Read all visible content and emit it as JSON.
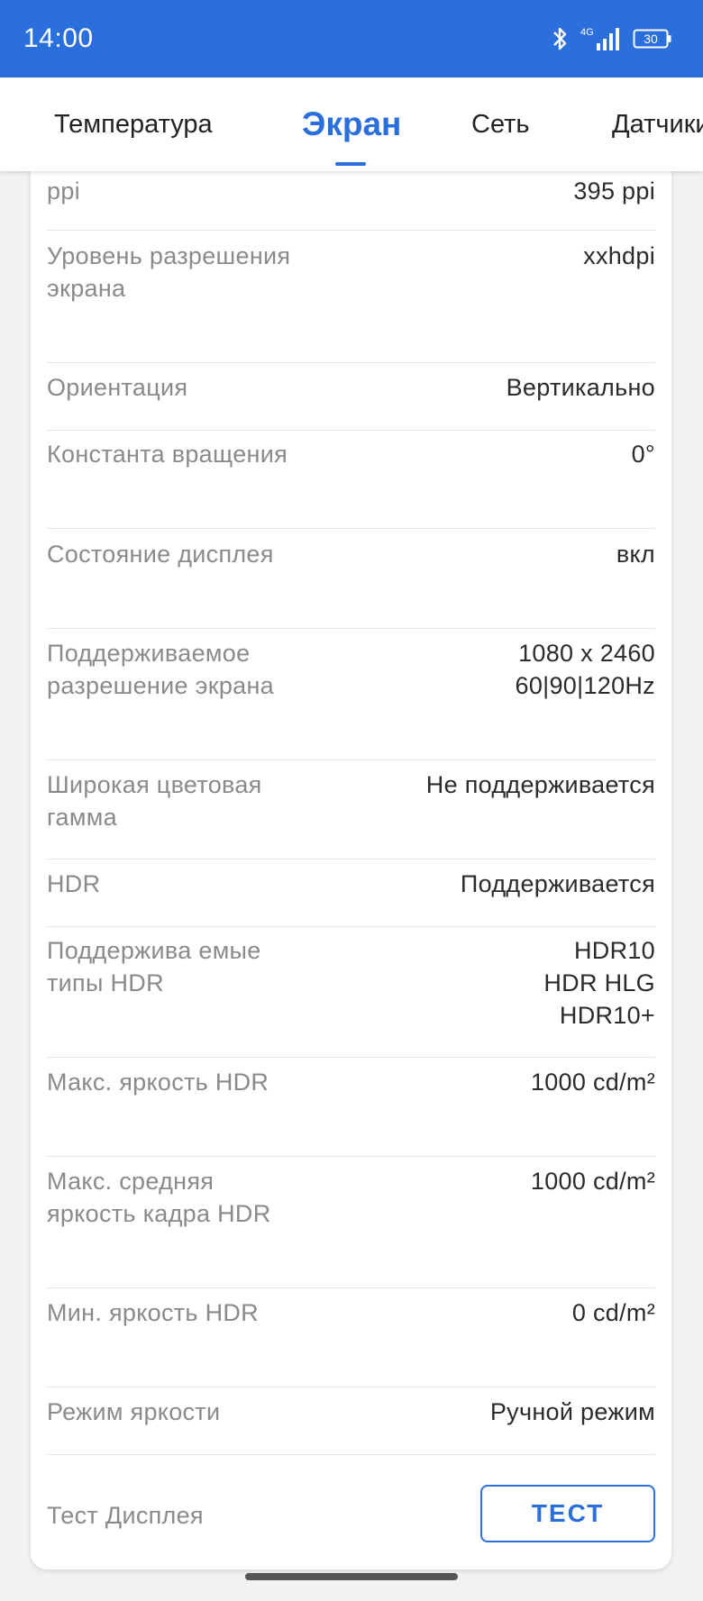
{
  "status_bar": {
    "time": "14:00",
    "network": "4G",
    "battery": "30",
    "icons": [
      "bluetooth-icon",
      "signal-icon",
      "battery-icon"
    ]
  },
  "tabs": [
    {
      "label": "Температура",
      "active": false
    },
    {
      "label": "Экран",
      "active": true
    },
    {
      "label": "Сеть",
      "active": false
    },
    {
      "label": "Датчики",
      "active": false
    }
  ],
  "rows": [
    {
      "label": "ppi",
      "value": [
        "395 ppi"
      ]
    },
    {
      "label": "Уровень разрешения экрана",
      "value": [
        "xxhdpi"
      ]
    },
    {
      "label": "Ориентация",
      "value": [
        "Вертикально"
      ]
    },
    {
      "label": "Константа вращения",
      "value": [
        "0°"
      ]
    },
    {
      "label": "Состояние дисплея",
      "value": [
        "вкл"
      ]
    },
    {
      "label": "Поддерживаемое разрешение экрана",
      "value": [
        "1080 x 2460",
        "60|90|120Hz"
      ]
    },
    {
      "label": "Широкая цветовая гамма",
      "value": [
        "Не поддерживается"
      ]
    },
    {
      "label": "HDR",
      "value": [
        "Поддерживается"
      ]
    },
    {
      "label": "Поддержива емые типы HDR",
      "value": [
        "HDR10",
        "HDR HLG",
        "HDR10+"
      ]
    },
    {
      "label": "Макс. яркость HDR",
      "value": [
        "1000 cd/m²"
      ]
    },
    {
      "label": "Макс. средняя яркость кадра HDR",
      "value": [
        "1000 cd/m²"
      ]
    },
    {
      "label": "Мин. яркость HDR",
      "value": [
        "0 cd/m²"
      ]
    },
    {
      "label": "Режим яркости",
      "value": [
        "Ручной режим"
      ]
    }
  ],
  "display_test": {
    "label": "Тест Дисплея",
    "button_label": "ТЕСТ"
  },
  "colors": {
    "accent": "#2a6fdb",
    "background": "#f2f2f2",
    "label_text": "#8a8a8a",
    "value_text": "#2b2b2b"
  }
}
